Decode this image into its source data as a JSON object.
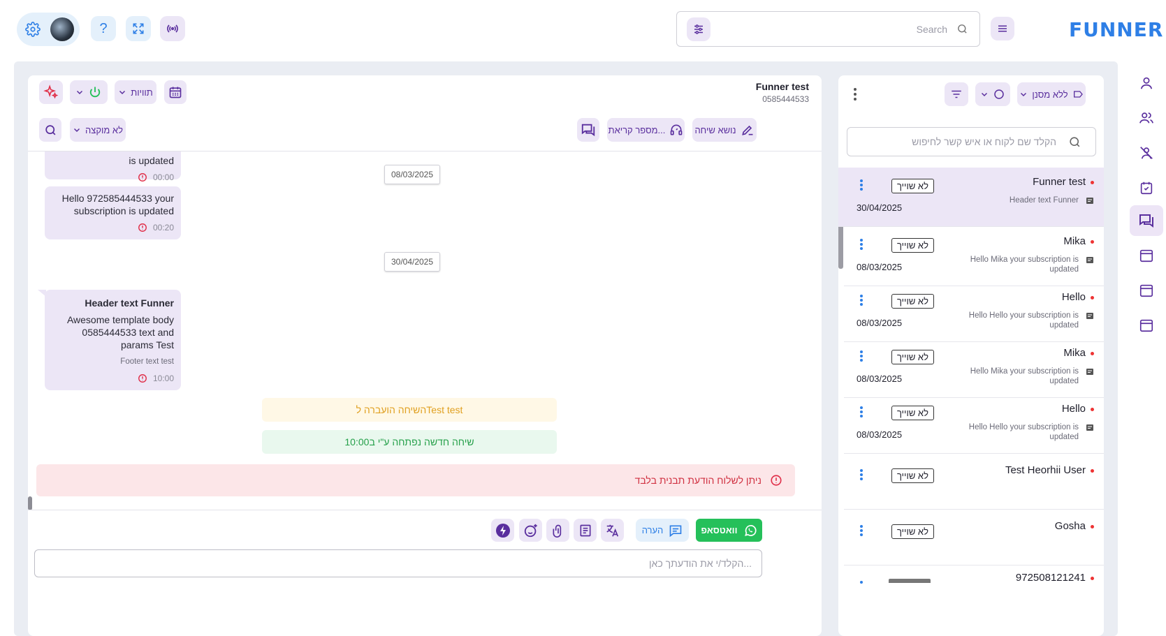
{
  "brand": {
    "logo": "FUNNER"
  },
  "search": {
    "placeholder": "Search"
  },
  "chat_header": {
    "contact_name": "Funner test",
    "contact_phone": "0585444533",
    "labels_dropdown": "תוויות",
    "unassigned_dropdown": "לא מוקצה",
    "topic_button": "נושא שיחה",
    "ticket_button": "מספר קריאת..."
  },
  "messages": {
    "msg1_text_tail": "is updated",
    "msg1_time": "00:00",
    "date1": "08/03/2025",
    "msg2_text": "Hello 972585444533 your subscription is updated",
    "msg2_time": "00:20",
    "date2": "30/04/2025",
    "msg3_header": "Header text Funner",
    "msg3_body": "Awesome template body 0585444533 text and params Test",
    "msg3_footer": "Footer text test",
    "msg3_time": "10:00",
    "transfer_note": "השיחה הועברה לTest test",
    "new_chat_note": "שיחה חדשה נפתחה ע\"י ב10:00"
  },
  "alert": {
    "text": "ניתן לשלוח הודעת תבנית בלבד"
  },
  "composer": {
    "whatsapp_button": "וואטסאפ",
    "note_button": "הערה",
    "placeholder": "הקלד/י את הודעתך כאן..."
  },
  "conv_list": {
    "filter_no_label": "ללא מסנן",
    "search_placeholder": "הקלד שם לקוח או איש קשר לחיפוש",
    "items": [
      {
        "name": "Funner test",
        "tag": "לא שוייך",
        "preview": "Header text Funner",
        "date": "30/04/2025"
      },
      {
        "name": "Mika",
        "tag": "לא שוייך",
        "preview": "Hello Mika your subscription is updated",
        "date": "08/03/2025"
      },
      {
        "name": "Hello",
        "tag": "לא שוייך",
        "preview": "Hello Hello your subscription is updated",
        "date": "08/03/2025"
      },
      {
        "name": "Mika",
        "tag": "לא שוייך",
        "preview": "Hello Mika your subscription is updated",
        "date": "08/03/2025"
      },
      {
        "name": "Hello",
        "tag": "לא שוייך",
        "preview": "Hello Hello your subscription is updated",
        "date": "08/03/2025"
      },
      {
        "name": "Test Heorhii User",
        "tag": "לא שוייך",
        "preview": "",
        "date": ""
      },
      {
        "name": "Gosha",
        "tag": "לא שוייך",
        "preview": "",
        "date": ""
      },
      {
        "name": "972508121241",
        "tag": "",
        "preview": "",
        "date": ""
      }
    ]
  },
  "colors": {
    "brand": "#2e7fe6",
    "accent": "#5a2f9e",
    "chip_bg": "#ece6f6",
    "whatsapp": "#25c05a",
    "alert_bg": "#fce6e8"
  }
}
